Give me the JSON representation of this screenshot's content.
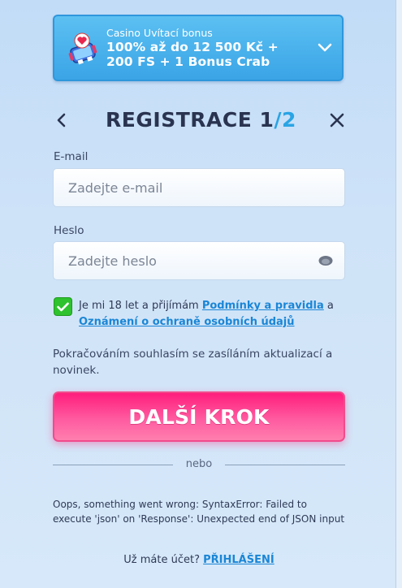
{
  "bonus": {
    "kicker": "Casino Uvítací bonus",
    "title_line1": "100% až do 12 500 Kč +",
    "title_line2": "200 FS + 1 Bonus Crab",
    "icon": "crab-machine-icon"
  },
  "header": {
    "title_prefix": "REGISTRACE 1",
    "slash": "/",
    "step_total": "2"
  },
  "form": {
    "email_label": "E-mail",
    "email_placeholder": "Zadejte e-mail",
    "password_label": "Heslo",
    "password_placeholder": "Zadejte heslo",
    "terms_checked": true,
    "terms_prefix": "Je mi 18 let a přijímám ",
    "terms_link1": "Podmínky a pravidla",
    "terms_mid": " a",
    "terms_link2": "Oznámení o ochraně osobních údajů",
    "consent_text": "Pokračováním souhlasím se zasíláním aktualizací a novinek.",
    "next_button": "DALŠÍ KROK"
  },
  "divider_text": "nebo",
  "error_text": "Oops, something went wrong: SyntaxError: Failed to execute 'json' on 'Response': Unexpected end of JSON input",
  "login": {
    "prompt": "Už máte účet? ",
    "link": "PŘIHLÁŠENÍ"
  },
  "colors": {
    "accent_blue": "#2aa4e4",
    "cta_pink": "#ff1e7c",
    "check_green": "#2ec22e",
    "link_blue": "#1a86d6"
  }
}
